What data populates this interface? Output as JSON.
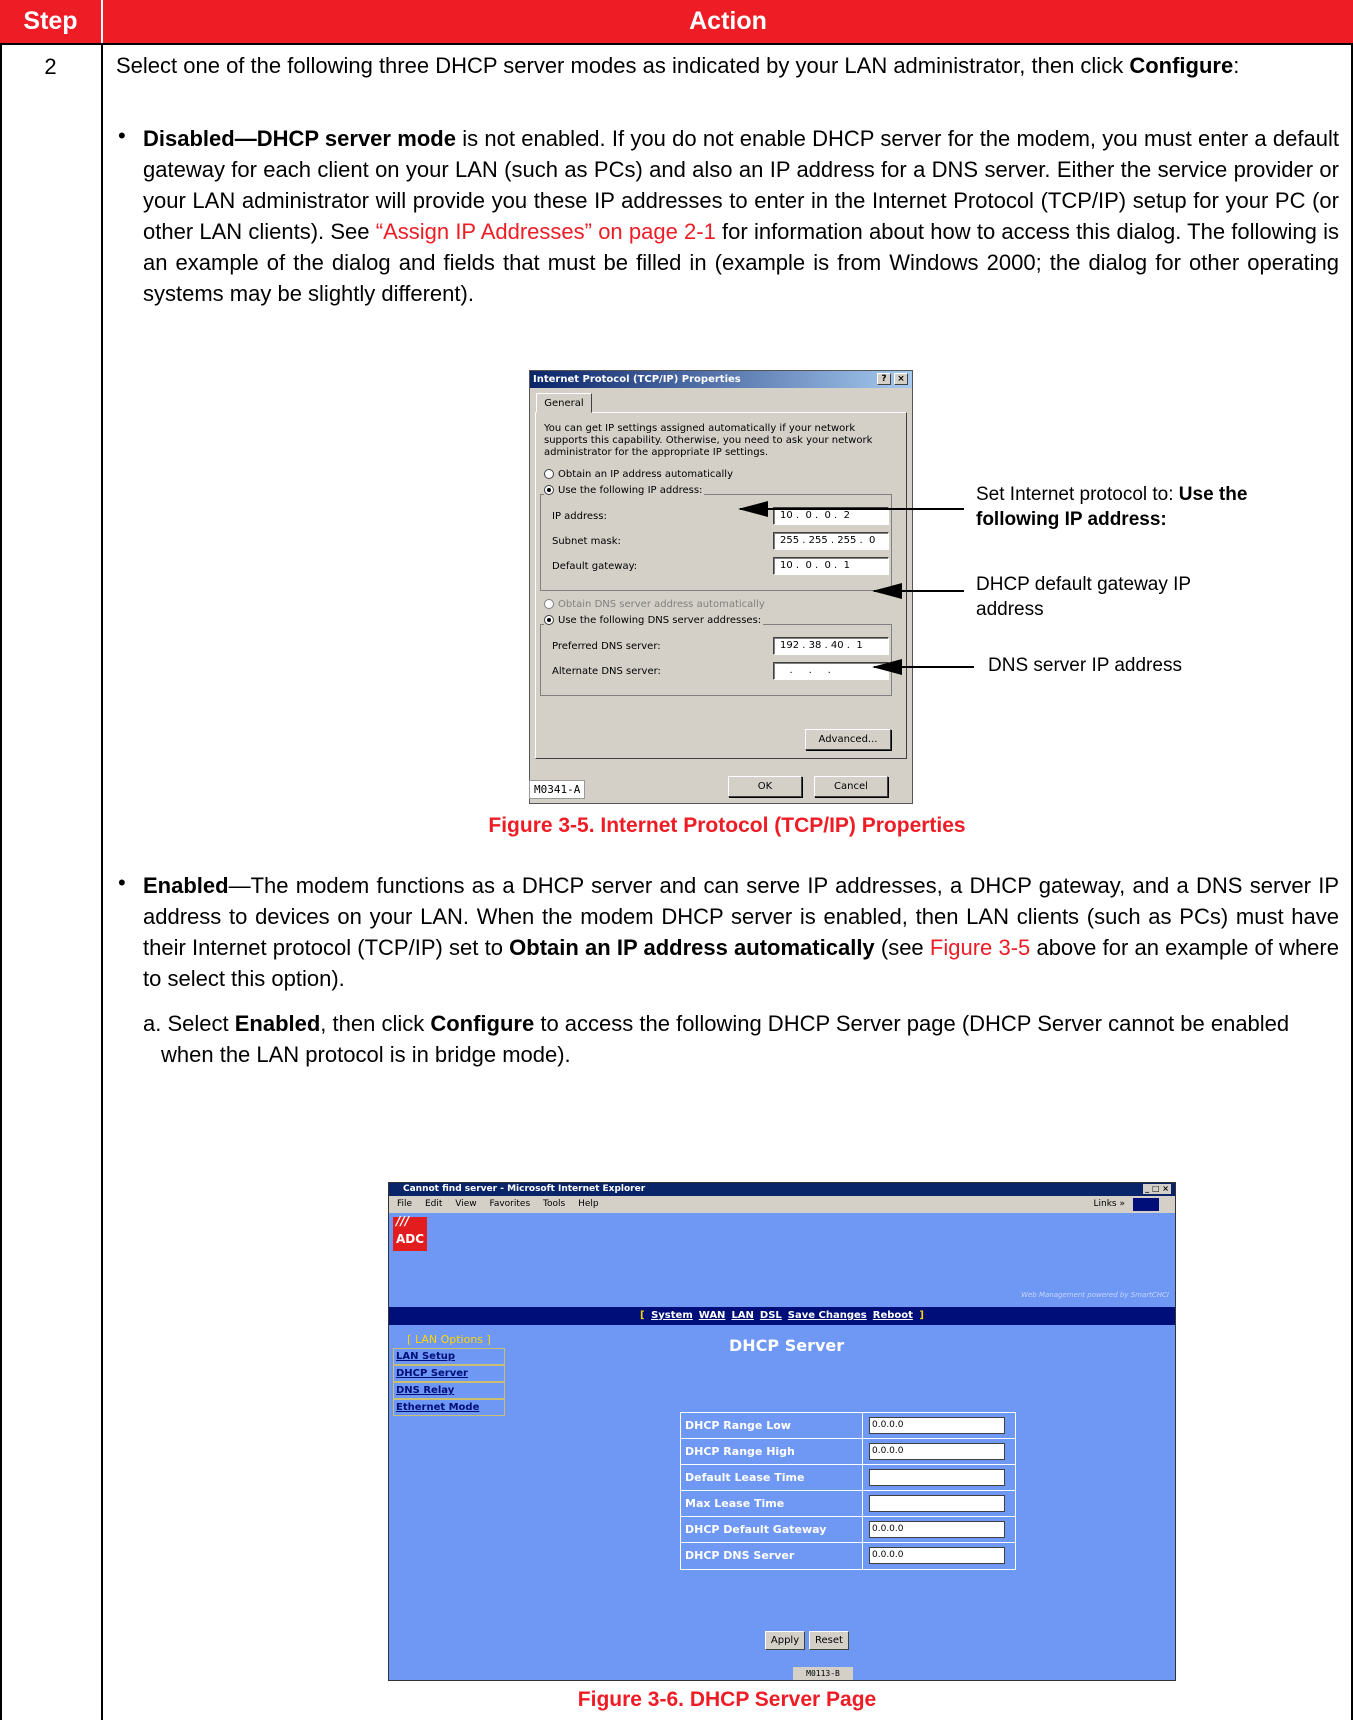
{
  "table": {
    "header_step": "Step",
    "header_action": "Action",
    "step_number": "2"
  },
  "intro": {
    "text": "Select one of the following three DHCP server modes as indicated by your LAN administrator, then click",
    "bold": "Configure",
    "tail": ":"
  },
  "bullet_disabled": {
    "bold": "Disabled—DHCP server mode",
    "text1": " is not enabled. If you do not enable DHCP server for the modem, you must enter a default gateway for each client on your LAN (such as PCs) and also an IP address for a DNS server. Either the service provider or your LAN administrator will provide you these IP addresses to enter in the Internet Protocol (TCP/IP) setup for your PC (or other LAN clients). See ",
    "link": "“Assign IP Addresses” on page 2-1",
    "text2": " for information about how to access this dialog. The following is an example of the dialog and fields that must be filled in (example is from Windows 2000; the dialog for other operating systems may be slightly different)."
  },
  "dialog": {
    "title": "Internet Protocol (TCP/IP) Properties",
    "help_btn": "?",
    "close_btn": "×",
    "tab": "General",
    "info": "You can get IP settings assigned automatically if your network supports this capability. Otherwise, you need to ask your network administrator for the appropriate IP settings.",
    "radio_auto_ip": "Obtain an IP address automatically",
    "radio_manual_ip": "Use the following IP address:",
    "ip_label": "IP address:",
    "ip_value": "10 .  0 .  0 .  2",
    "mask_label": "Subnet mask:",
    "mask_value": "255 . 255 . 255 .  0",
    "gateway_label": "Default gateway:",
    "gateway_value": "10 .  0 .  0 .  1",
    "radio_auto_dns": "Obtain DNS server address automatically",
    "radio_manual_dns": "Use the following DNS server addresses:",
    "pref_dns_label": "Preferred DNS server:",
    "pref_dns_value": "192 . 38 . 40 .  1",
    "alt_dns_label": "Alternate DNS server:",
    "alt_dns_value": "   .     .     .   ",
    "advanced_btn": "Advanced...",
    "ok_btn": "OK",
    "cancel_btn": "Cancel",
    "figure_code": "M0341-A"
  },
  "callouts": {
    "c1_text": "Set Internet protocol to: ",
    "c1_bold": "Use the following IP address:",
    "c2": "DHCP default gateway IP address",
    "c3": "DNS server IP address"
  },
  "figure5_caption": "Figure 3-5. Internet Protocol (TCP/IP) Properties",
  "bullet_enabled": {
    "bold": "Enabled",
    "text1": "—The modem functions as a DHCP server and can serve IP addresses, a DHCP gateway, and a DNS server IP address to devices on your LAN. When the modem DHCP server is enabled, then LAN clients (such as PCs) must have their Internet protocol (TCP/IP) set to ",
    "bold2": "Obtain an IP address automatically",
    "text2": " (see ",
    "link": "Figure 3-5",
    "text3": " above for an example of where to select this option)."
  },
  "sub_a": {
    "text1": "a. Select ",
    "bold1": "Enabled",
    "text2": ", then click ",
    "bold2": "Configure",
    "text3": " to access the following DHCP Server page (DHCP Server cannot be enabled when the LAN protocol is in bridge mode)."
  },
  "ie": {
    "title": "Cannot find server - Microsoft Internet Explorer",
    "menu": [
      "File",
      "Edit",
      "View",
      "Favorites",
      "Tools",
      "Help"
    ],
    "links": "Links »",
    "logo": "ADC",
    "powered": "Web Management powered by SmartCHCI",
    "nav": [
      "System",
      "WAN",
      "LAN",
      "DSL",
      "Save Changes",
      "Reboot"
    ],
    "side_title": "[ LAN Options ]",
    "side_items": [
      "LAN Setup",
      "DHCP Server",
      "DNS Relay",
      "Ethernet Mode"
    ],
    "page_title": "DHCP Server",
    "fields": [
      {
        "label": "DHCP Range Low",
        "value": "0.0.0.0"
      },
      {
        "label": "DHCP Range High",
        "value": "0.0.0.0"
      },
      {
        "label": "Default Lease Time",
        "value": ""
      },
      {
        "label": "Max Lease Time",
        "value": ""
      },
      {
        "label": "DHCP Default Gateway",
        "value": "0.0.0.0"
      },
      {
        "label": "DHCP DNS Server",
        "value": "0.0.0.0"
      }
    ],
    "apply_btn": "Apply",
    "reset_btn": "Reset",
    "figure_code": "M0113-B"
  },
  "figure6_caption": "Figure 3-6. DHCP Server Page",
  "colors": {
    "header_red": "#ee1c25",
    "link_red": "#ee1c25",
    "ie_blue": "#6f97f4",
    "nav_navy": "#000e7a"
  }
}
